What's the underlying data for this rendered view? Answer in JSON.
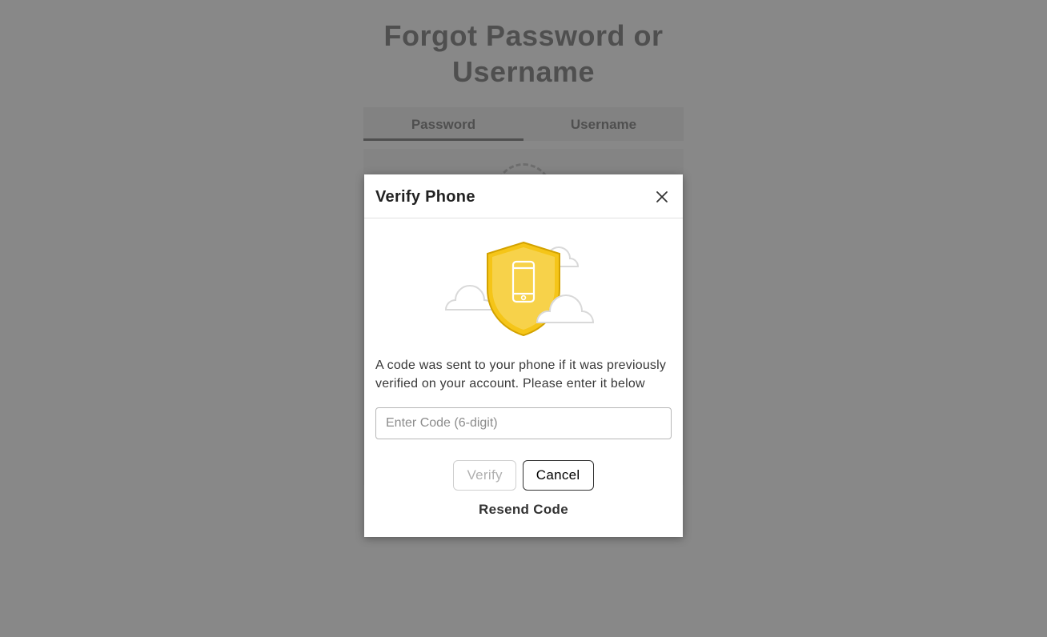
{
  "page": {
    "title_line1": "Forgot Password or",
    "title_line2": "Username"
  },
  "tabs": {
    "password": "Password",
    "username": "Username",
    "active": "password"
  },
  "modal": {
    "title": "Verify Phone",
    "instruction": "A code was sent to your phone if it was previously verified on your account. Please enter it below",
    "input_placeholder": "Enter Code (6-digit)",
    "input_value": "",
    "verify_label": "Verify",
    "cancel_label": "Cancel",
    "resend_label": "Resend Code",
    "verify_disabled": true
  },
  "icons": {
    "close": "close-icon",
    "shield": "shield-phone-icon"
  },
  "colors": {
    "shield_fill": "#f5c518",
    "shield_stroke": "#d3a200",
    "cloud_stroke": "#d9d9d9",
    "cloud_fill": "#ffffff",
    "overlay": "rgba(90,90,90,0.72)"
  }
}
